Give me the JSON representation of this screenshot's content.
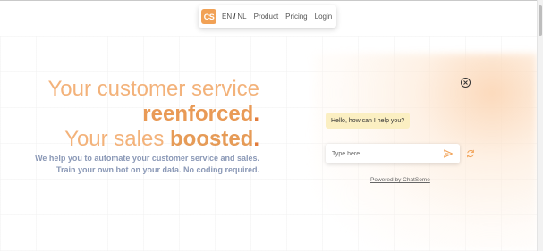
{
  "nav": {
    "logo_text": "CS",
    "lang_en": "EN",
    "lang_sep": "/",
    "lang_nl": "NL",
    "links": [
      "Product",
      "Pricing",
      "Login"
    ]
  },
  "hero": {
    "line1": "Your customer service",
    "line2_bold": "reenforced",
    "line2_dot": ".",
    "line3_plain": "Your sales ",
    "line3_bold": "boosted",
    "line3_dot": ".",
    "sub_line1": "We help you to automate your customer service and sales.",
    "sub_line2": "Train your own bot on your data. No coding required."
  },
  "chat": {
    "greeting": "Hello, how can I help you?",
    "input_placeholder": "Type here...",
    "input_value": "",
    "powered_by": "Powered by ChatSome",
    "close_icon": "close-circle-icon",
    "send_icon": "send-icon",
    "refresh_icon": "refresh-icon"
  },
  "colors": {
    "accent": "#f1a155",
    "hero_light": "#f3b27a",
    "hero_bold": "#e99a56",
    "subtext": "#8a98b6",
    "bubble_bg": "#fbefc2"
  }
}
